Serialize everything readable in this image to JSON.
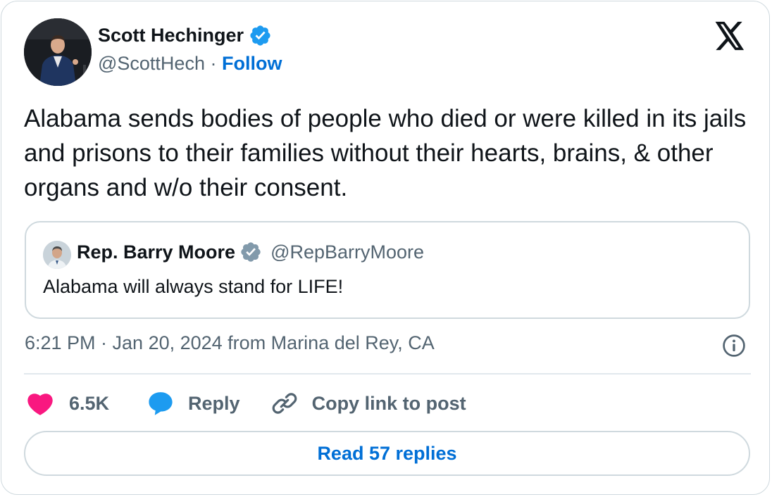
{
  "author": {
    "display_name": "Scott Hechinger",
    "handle": "@ScottHech",
    "separator": " · ",
    "follow_label": "Follow",
    "verified_color": "#1d9bf0"
  },
  "tweet": {
    "text": "Alabama sends bodies of people who died or were killed in its jails and prisons to their families without their hearts, brains, & other organs and w/o their consent."
  },
  "quoted": {
    "display_name": "Rep. Barry Moore",
    "handle": "@RepBarryMoore",
    "text": "Alabama will always stand for LIFE!",
    "verified_color": "#829aab"
  },
  "meta": {
    "timestamp": "6:21 PM · Jan 20, 2024 from Marina del Rey, CA"
  },
  "actions": {
    "like_count": "6.5K",
    "reply_label": "Reply",
    "copy_label": "Copy link to post"
  },
  "read_replies_label": "Read 57 replies",
  "colors": {
    "accent": "#006fd6",
    "like": "#f91880",
    "reply": "#1d9bf0",
    "muted": "#536471"
  }
}
